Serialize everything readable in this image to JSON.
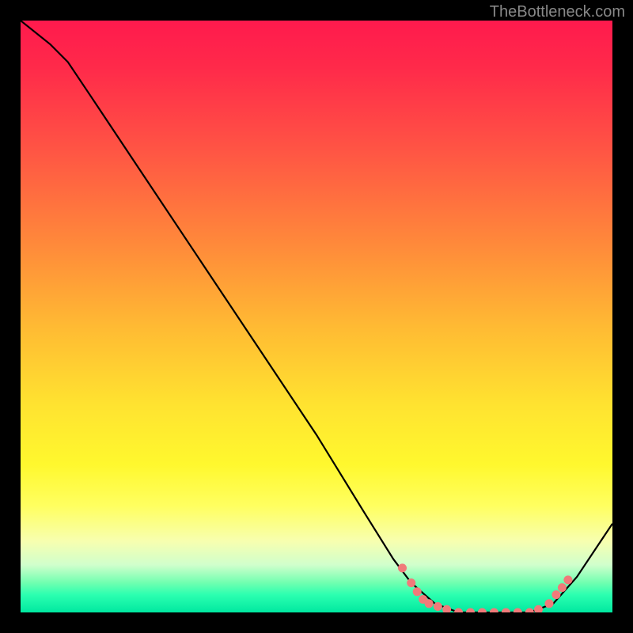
{
  "attribution": "TheBottleneck.com",
  "chart_data": {
    "type": "line",
    "title": "",
    "xlabel": "",
    "ylabel": "",
    "series": [
      {
        "name": "curve",
        "points": [
          {
            "x": 0.0,
            "y": 1.0
          },
          {
            "x": 0.05,
            "y": 0.96
          },
          {
            "x": 0.08,
            "y": 0.93
          },
          {
            "x": 0.12,
            "y": 0.87
          },
          {
            "x": 0.2,
            "y": 0.75
          },
          {
            "x": 0.3,
            "y": 0.6
          },
          {
            "x": 0.4,
            "y": 0.45
          },
          {
            "x": 0.5,
            "y": 0.3
          },
          {
            "x": 0.58,
            "y": 0.17
          },
          {
            "x": 0.63,
            "y": 0.09
          },
          {
            "x": 0.66,
            "y": 0.05
          },
          {
            "x": 0.7,
            "y": 0.015
          },
          {
            "x": 0.74,
            "y": 0.0
          },
          {
            "x": 0.8,
            "y": 0.0
          },
          {
            "x": 0.86,
            "y": 0.0
          },
          {
            "x": 0.9,
            "y": 0.015
          },
          {
            "x": 0.94,
            "y": 0.06
          },
          {
            "x": 1.0,
            "y": 0.15
          }
        ]
      },
      {
        "name": "markers",
        "points": [
          {
            "x": 0.645,
            "y": 0.075
          },
          {
            "x": 0.66,
            "y": 0.05
          },
          {
            "x": 0.67,
            "y": 0.035
          },
          {
            "x": 0.68,
            "y": 0.022
          },
          {
            "x": 0.69,
            "y": 0.015
          },
          {
            "x": 0.705,
            "y": 0.01
          },
          {
            "x": 0.72,
            "y": 0.005
          },
          {
            "x": 0.74,
            "y": 0.0
          },
          {
            "x": 0.76,
            "y": 0.0
          },
          {
            "x": 0.78,
            "y": 0.0
          },
          {
            "x": 0.8,
            "y": 0.0
          },
          {
            "x": 0.82,
            "y": 0.0
          },
          {
            "x": 0.84,
            "y": 0.0
          },
          {
            "x": 0.86,
            "y": 0.0
          },
          {
            "x": 0.875,
            "y": 0.005
          },
          {
            "x": 0.893,
            "y": 0.015
          },
          {
            "x": 0.905,
            "y": 0.03
          },
          {
            "x": 0.915,
            "y": 0.042
          },
          {
            "x": 0.925,
            "y": 0.055
          }
        ]
      }
    ],
    "xlim": [
      0,
      1
    ],
    "ylim": [
      0,
      1
    ],
    "background": "rainbow-gradient-vertical"
  }
}
